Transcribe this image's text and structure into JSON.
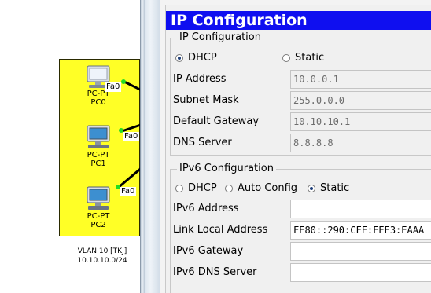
{
  "workspace": {
    "pcs": [
      {
        "type": "PC-PT",
        "name": "PC0",
        "port": "Fa0"
      },
      {
        "type": "PC-PT",
        "name": "PC1",
        "port": "Fa0"
      },
      {
        "type": "PC-PT",
        "name": "PC2",
        "port": "Fa0"
      }
    ],
    "vlan_caption_line1": "VLAN 10 [TKJ]",
    "vlan_caption_line2": "10.10.10.0/24",
    "colors": {
      "vlan_fill": "#ffff26",
      "link_light": "#22dd22"
    }
  },
  "dialog": {
    "title": "IP Configuration",
    "title_color": "#0f0ff0",
    "ipv4": {
      "legend": "IP Configuration",
      "dhcp_label": "DHCP",
      "static_label": "Static",
      "selected": "DHCP",
      "ip_label": "IP Address",
      "ip_value": "10.0.0.1",
      "mask_label": "Subnet Mask",
      "mask_value": "255.0.0.0",
      "gateway_label": "Default Gateway",
      "gateway_value": "10.10.10.1",
      "dns_label": "DNS Server",
      "dns_value": "8.8.8.8"
    },
    "ipv6": {
      "legend": "IPv6 Configuration",
      "dhcp_label": "DHCP",
      "auto_label": "Auto Config",
      "static_label": "Static",
      "selected": "Static",
      "address_label": "IPv6 Address",
      "address_value": "",
      "link_local_label": "Link Local Address",
      "link_local_value": "FE80::290:CFF:FEE3:EAAA",
      "gateway_label": "IPv6 Gateway",
      "gateway_value": "",
      "dns_label": "IPv6 DNS Server",
      "dns_value": ""
    }
  }
}
